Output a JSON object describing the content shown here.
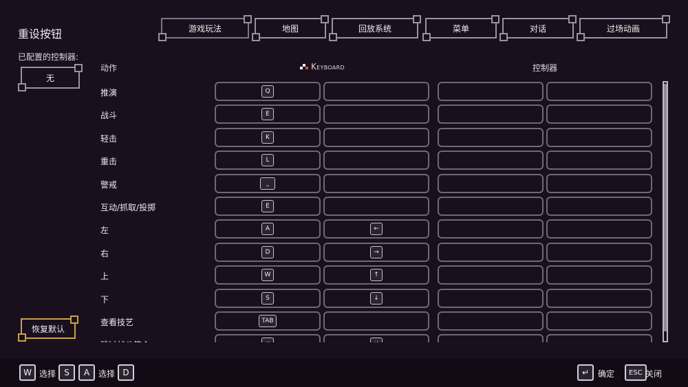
{
  "page_title": "重设按钮",
  "controller_label": "已配置的控制器:",
  "controller_value": "无",
  "restore_label": "恢复默认",
  "tabs": [
    "游戏玩法",
    "地图",
    "回放系统",
    "菜单",
    "对话",
    "过场动画"
  ],
  "active_tab": 0,
  "headers": {
    "action": "动作",
    "keyboard": "Keyboard",
    "controller": "控制器"
  },
  "rows": [
    {
      "action": "推演",
      "key1": "Q",
      "key2": ""
    },
    {
      "action": "战斗",
      "key1": "E",
      "key2": ""
    },
    {
      "action": "轻击",
      "key1": "K",
      "key2": ""
    },
    {
      "action": "重击",
      "key1": "L",
      "key2": ""
    },
    {
      "action": "警戒",
      "key1": "⎵",
      "key2": ""
    },
    {
      "action": "互动/抓取/投掷",
      "key1": "E",
      "key2": ""
    },
    {
      "action": "左",
      "key1": "A",
      "key2": "←"
    },
    {
      "action": "右",
      "key1": "D",
      "key2": "→"
    },
    {
      "action": "上",
      "key1": "W",
      "key2": "↑"
    },
    {
      "action": "下",
      "key1": "S",
      "key2": "↓"
    },
    {
      "action": "查看技艺",
      "key1": "TAB",
      "key2": ""
    },
    {
      "action": "跳过战斗简介",
      "key1": "↵",
      "key2": "↵"
    }
  ],
  "footer": {
    "key_w": "W",
    "select1": "选择",
    "key_s": "S",
    "key_a": "A",
    "select2": "选择",
    "key_d": "D",
    "key_enter": "↵",
    "confirm": "确定",
    "key_esc": "ESC",
    "close": "关闭"
  }
}
